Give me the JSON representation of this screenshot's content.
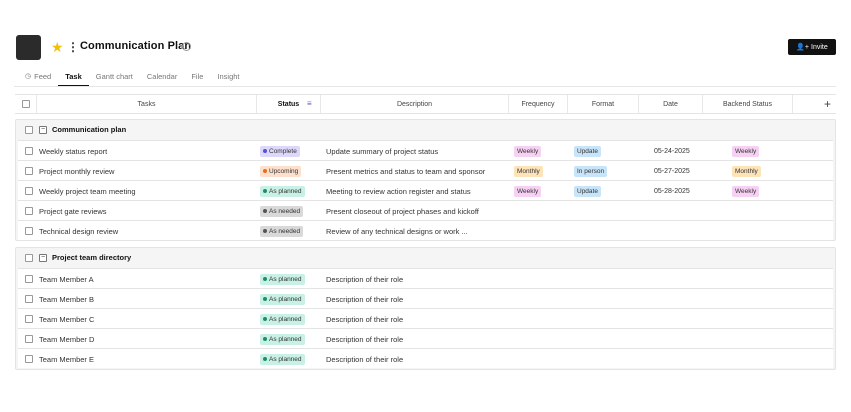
{
  "header": {
    "title": "Communication Plan",
    "invite_label": "Invite"
  },
  "tabs": [
    {
      "label": "Feed",
      "active": false
    },
    {
      "label": "Task",
      "active": true
    },
    {
      "label": "Gantt chart",
      "active": false
    },
    {
      "label": "Calendar",
      "active": false
    },
    {
      "label": "File",
      "active": false
    },
    {
      "label": "Insight",
      "active": false
    }
  ],
  "columns": {
    "tasks": "Tasks",
    "status": "Status",
    "description": "Description",
    "frequency": "Frequency",
    "format": "Format",
    "date": "Date",
    "backend_status": "Backend Status"
  },
  "groups": [
    {
      "title": "Communication plan",
      "rows": [
        {
          "task": "Weekly status report",
          "status": "Complete",
          "description": "Update summary of project status",
          "frequency": "Weekly",
          "format": "Update",
          "date": "05-24-2025",
          "backend": "Weekly"
        },
        {
          "task": "Project monthly review",
          "status": "Upcoming",
          "description": "Present metrics and status to team and sponsor",
          "frequency": "Monthly",
          "format": "In person",
          "date": "05-27-2025",
          "backend": "Monthly"
        },
        {
          "task": "Weekly project team meeting",
          "status": "As planned",
          "description": "Meeting to review action register and status",
          "frequency": "Weekly",
          "format": "Update",
          "date": "05-28-2025",
          "backend": "Weekly"
        },
        {
          "task": "Project gate reviews",
          "status": "As needed",
          "description": "Present closeout of project phases and kickoff",
          "frequency": "",
          "format": "",
          "date": "",
          "backend": ""
        },
        {
          "task": "Technical design review",
          "status": "As needed",
          "description": "Review of any technical designs or work ...",
          "frequency": "",
          "format": "",
          "date": "",
          "backend": ""
        }
      ]
    },
    {
      "title": "Project team directory",
      "rows": [
        {
          "task": "Team Member A",
          "status": "As planned",
          "description": "Description of their role"
        },
        {
          "task": "Team Member B",
          "status": "As planned",
          "description": "Description of their role"
        },
        {
          "task": "Team Member C",
          "status": "As planned",
          "description": "Description of their role"
        },
        {
          "task": "Team Member D",
          "status": "As planned",
          "description": "Description of their role"
        },
        {
          "task": "Team Member E",
          "status": "As planned",
          "description": "Description of their role"
        }
      ]
    }
  ],
  "colors": {
    "complete": "#5b4fd6",
    "upcoming": "#ef6c1a",
    "as_planned": "#1f8f6b",
    "as_needed": "#555555",
    "weekly_tag": "#f7d1f3",
    "monthly_tag": "#fde3b8",
    "format_tag": "#c8e4f8"
  },
  "icons": [
    "star-icon",
    "more-vertical-icon",
    "globe-icon",
    "add-user-icon",
    "feed-icon",
    "filter-icon",
    "plus-icon"
  ]
}
